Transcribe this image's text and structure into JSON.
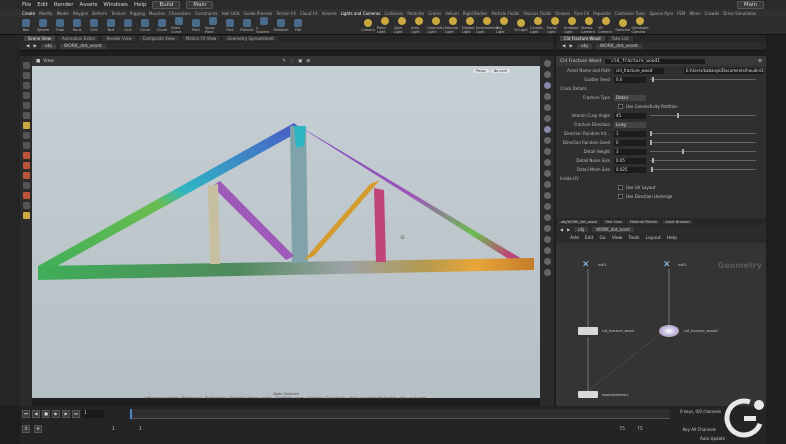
{
  "menubar": {
    "items": [
      "File",
      "Edit",
      "Render",
      "Assets",
      "Windows",
      "Help"
    ],
    "desktop": "Build",
    "workspace": "Main"
  },
  "shelf_tabs": [
    "Create",
    "Modify",
    "Model",
    "Polygon",
    "Deform",
    "Texture",
    "Rigging",
    "Muscles",
    "Characters",
    "Constraints",
    "Hair Utils",
    "Guide Process",
    "Terrain FX",
    "Cloud FX",
    "Volume",
    "Lights and Cameras",
    "Collisions",
    "Particles",
    "Grains",
    "Vellum",
    "Rigid Bodies",
    "Particle Fluids",
    "Viscous Fluids",
    "Oceans",
    "Pyro FX",
    "Populate",
    "Container Tools",
    "Sparse Pyro",
    "FEM",
    "Wires",
    "Crowds",
    "Drive Simulation"
  ],
  "shelf_tools": [
    "Box",
    "Sphere",
    "Tube",
    "Torus",
    "Grid",
    "Null",
    "Line",
    "Circle",
    "Curve",
    "Draw Curve",
    "Path",
    "Spray Paint",
    "Font",
    "Platonic",
    "L-System",
    "Metaball",
    "File"
  ],
  "light_tools": [
    "Camera",
    "Point Light",
    "Spot Light",
    "Area Light",
    "Geometry Light",
    "Volume Light",
    "Distant Light",
    "Environment Light",
    "Sky Light",
    "GI Light",
    "Caustic Light",
    "Portal Light",
    "Ambient Light",
    "Stereo Camera",
    "VR Camera",
    "Switcher",
    "Gamepad Camera"
  ],
  "pane_tabs": [
    "Scene View",
    "Animation Editor",
    "Render View",
    "Composite View",
    "Motion FX View",
    "Geometry Spreadsheet"
  ],
  "path": {
    "context": "obj",
    "node": "WORK_dot_asset"
  },
  "view_label": "View",
  "viewport": {
    "persp": "Persp",
    "cam": "No cam",
    "status_line": "Left mouse tumbles. Middle pans. Right dollies. Ctrl+Alt+Left box-zooms. Ctrl+Right zooms. Spacebar-Ctrl-Left tilts. Hold L for alternate tumble, dolly, and zoom.",
    "selection_status": "Node Selected",
    "truss_colors": [
      "#3fae58",
      "#2fb6c4",
      "#7b3fbd",
      "#c0457a",
      "#d49c2f",
      "#e8a63a",
      "#b59a4f",
      "#4c58c8",
      "#9d5ab8",
      "#6bbd4f",
      "#c6c0a0"
    ]
  },
  "params": {
    "tabs": [
      "Cld Fracture Wood",
      "Take List"
    ],
    "node_type": "Cld Fracture Wood",
    "node_name": "cld_fracture_wood1",
    "asset_name_label": "Asset Name and Path",
    "asset_name": "cld_fracture_wood",
    "asset_path": "E:/Users/kabanyk/Documents/houdini19.0/otls/fracture_wood.hda",
    "scatter_seed_label": "Scatter Seed",
    "scatter_seed": "0.0",
    "crack_details_label": "Crack Details",
    "fracture_type_label": "Fracture Type",
    "fracture_type": "Detail",
    "use_connectivity_label": "Use Connectivity Partition",
    "interior_cusp_label": "Interior Cusp Angle",
    "interior_cusp": "45",
    "fracture_direction_label": "Fracture Direction",
    "fracture_direction": "Long",
    "dir_random_int_label": "Direction Random Int...",
    "dir_random_int": "1",
    "dir_random_seed_label": "Direction Random Seed",
    "dir_random_seed": "0",
    "detail_height_label": "Detail Height",
    "detail_height": "3",
    "detail_noise_label": "Detail Noise Size",
    "detail_noise": "0.05",
    "detail_mesh_label": "Detail Mesh Size",
    "detail_mesh": "0.025",
    "inside_uv_label": "Inside UV",
    "use_uv_layout_label": "Use UV Layout",
    "use_dir_uv_label": "Use Direction Uvmerge"
  },
  "network": {
    "tabs": [
      "obj/WORK_dot_asset",
      "Tree View",
      "Material Palette",
      "Asset Browser"
    ],
    "context": "obj",
    "node": "WORK_dot_asset",
    "menu": [
      "Add",
      "Edit",
      "Go",
      "View",
      "Tools",
      "Layout",
      "Help"
    ],
    "context_label": "Geometry",
    "nodes": {
      "null1": "null1",
      "null2": "null2",
      "fracture_wood": "cld_fracture_wood",
      "fracture_wood1": "cld_fracture_wood1",
      "explode": "explodedview1"
    }
  },
  "timeline": {
    "current_frame": "1",
    "start": "1",
    "start2": "1",
    "end": "75",
    "end2": "75",
    "keys_label": "0 keys, 0/0 channels",
    "key_all_label": "Key All Channels",
    "auto_update": "Auto Update"
  }
}
